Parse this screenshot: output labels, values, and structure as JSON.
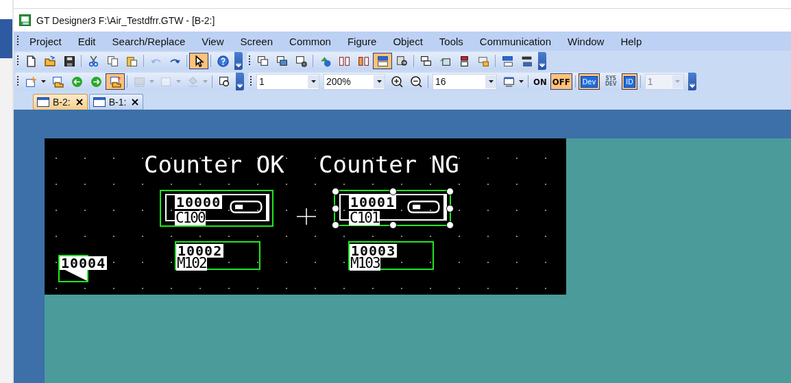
{
  "window": {
    "title": "GT Designer3 F:\\Air_Testdfrr.GTW - [B-2:]"
  },
  "menu": [
    "Project",
    "Edit",
    "Search/Replace",
    "View",
    "Screen",
    "Common",
    "Figure",
    "Object",
    "Tools",
    "Communication",
    "Window",
    "Help"
  ],
  "toolbars": [
    {
      "buttons": [
        {
          "kind": "icon",
          "pressed": false,
          "disabled": false
        },
        {
          "kind": "icon",
          "pressed": false,
          "disabled": false
        },
        {
          "kind": "icon",
          "pressed": false,
          "disabled": false
        },
        {
          "kind": "icon",
          "pressed": false,
          "disabled": false
        },
        {
          "kind": "icon",
          "pressed": false,
          "disabled": false
        },
        {
          "kind": "icon",
          "pressed": false,
          "disabled": false
        },
        {
          "kind": "icon",
          "pressed": false,
          "disabled": true
        },
        {
          "kind": "icon",
          "pressed": false,
          "disabled": false
        },
        {
          "kind": "icon",
          "pressed": true,
          "disabled": false
        },
        {
          "kind": "icon",
          "pressed": false,
          "disabled": false
        }
      ]
    },
    {
      "buttons": [
        {
          "kind": "icon",
          "pressed": false,
          "disabled": false
        },
        {
          "kind": "icon",
          "pressed": false,
          "disabled": false
        },
        {
          "kind": "icon",
          "pressed": false,
          "disabled": false
        },
        {
          "kind": "icon",
          "pressed": false,
          "disabled": false
        },
        {
          "kind": "icon",
          "pressed": false,
          "disabled": false
        },
        {
          "kind": "icon",
          "pressed": false,
          "disabled": false
        },
        {
          "kind": "icon",
          "pressed": true,
          "disabled": false
        },
        {
          "kind": "icon",
          "pressed": false,
          "disabled": false
        },
        {
          "kind": "icon",
          "pressed": false,
          "disabled": false
        },
        {
          "kind": "icon",
          "pressed": false,
          "disabled": false
        },
        {
          "kind": "icon",
          "pressed": false,
          "disabled": false
        },
        {
          "kind": "icon",
          "pressed": false,
          "disabled": false
        },
        {
          "kind": "icon",
          "pressed": false,
          "disabled": false
        },
        {
          "kind": "icon",
          "pressed": false,
          "disabled": false
        }
      ]
    },
    {
      "buttons": [
        {
          "kind": "icon",
          "pressed": false,
          "disabled": false
        },
        {
          "kind": "icon",
          "pressed": false,
          "disabled": false
        },
        {
          "kind": "icon",
          "pressed": false,
          "disabled": false
        },
        {
          "kind": "icon",
          "pressed": false,
          "disabled": false
        },
        {
          "kind": "icon",
          "pressed": true,
          "disabled": false
        },
        {
          "kind": "icon",
          "pressed": false,
          "disabled": true
        },
        {
          "kind": "icon",
          "pressed": false,
          "disabled": true
        },
        {
          "kind": "icon",
          "pressed": false,
          "disabled": true
        },
        {
          "kind": "icon",
          "pressed": false,
          "disabled": false
        }
      ]
    },
    {
      "buttons": [
        {
          "kind": "combo",
          "value": "1",
          "disabled": false
        },
        {
          "kind": "combo",
          "value": "200%",
          "disabled": false
        },
        {
          "kind": "icon",
          "pressed": false,
          "disabled": false
        },
        {
          "kind": "icon",
          "pressed": false,
          "disabled": false
        },
        {
          "kind": "combo",
          "value": "16",
          "disabled": false
        },
        {
          "kind": "icon",
          "pressed": false,
          "disabled": false
        },
        {
          "kind": "text",
          "label": "ON",
          "pressed": false,
          "disabled": false
        },
        {
          "kind": "text",
          "label": "OFF",
          "pressed": true,
          "disabled": false
        },
        {
          "kind": "text",
          "label": "Dev",
          "pressed": true,
          "disabled": false
        },
        {
          "kind": "text",
          "label": "SYS DEV",
          "pressed": false,
          "disabled": true
        },
        {
          "kind": "text",
          "label": "ID",
          "pressed": true,
          "disabled": false
        },
        {
          "kind": "combo",
          "value": "1",
          "disabled": true
        }
      ]
    }
  ],
  "tabs": [
    {
      "label": "B-2:",
      "selected": true
    },
    {
      "label": "B-1:",
      "selected": false
    }
  ],
  "screen_texts": [
    "Counter OK",
    "Counter NG"
  ],
  "screen_objects": [
    {
      "kind": "switch",
      "number": "10000",
      "device": "C100",
      "selected": false
    },
    {
      "kind": "switch",
      "number": "10001",
      "device": "C101",
      "selected": true
    },
    {
      "kind": "bit",
      "number": "10004",
      "selected": false
    },
    {
      "kind": "lamp",
      "number": "10002",
      "device": "M102",
      "selected": false
    },
    {
      "kind": "lamp",
      "number": "10003",
      "device": "M103",
      "selected": false
    }
  ]
}
